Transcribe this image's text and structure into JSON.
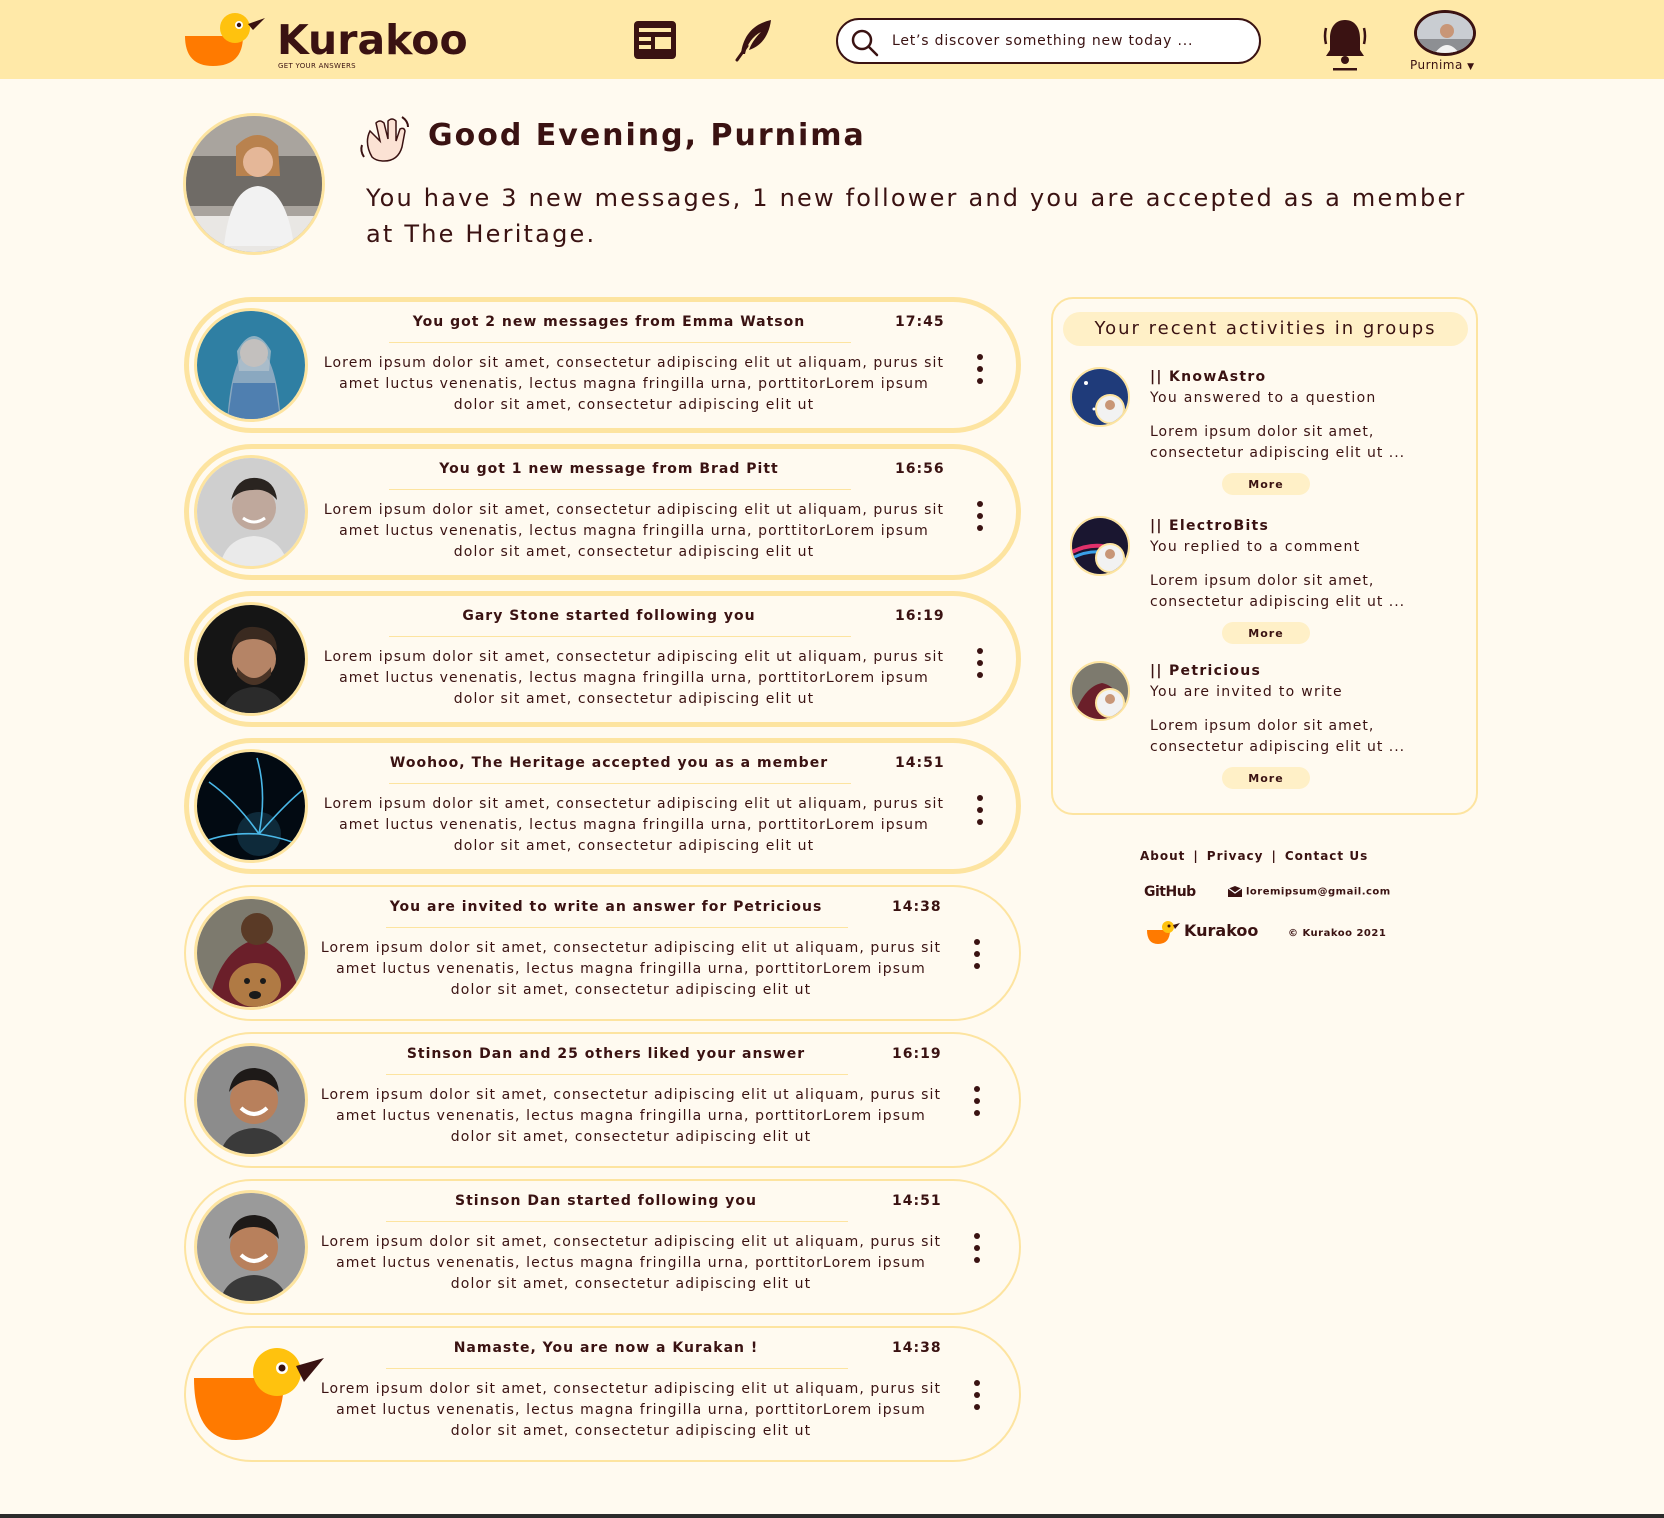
{
  "brand": {
    "name": "Kurakoo",
    "tagline": "GET YOUR ANSWERS"
  },
  "header": {
    "search_placeholder": "Let’s discover something new today ...",
    "user_name": "Purnima"
  },
  "greeting": {
    "title": "Good Evening, Purnima",
    "message": "You have 3 new messages, 1 new follower and you are accepted as a member at The Heritage."
  },
  "notifications": [
    {
      "title": "You got 2 new messages from Emma Watson",
      "time": "17:45",
      "body": "Lorem ipsum dolor sit amet, consectetur adipiscing elit ut aliquam, purus sit amet luctus venenatis, lectus magna fringilla urna, porttitorLorem ipsum dolor sit amet, consectetur adipiscing elit ut"
    },
    {
      "title": "You got 1 new message from Brad Pitt",
      "time": "16:56",
      "body": "Lorem ipsum dolor sit amet, consectetur adipiscing elit ut aliquam, purus sit amet luctus venenatis, lectus magna fringilla urna, porttitorLorem ipsum dolor sit amet, consectetur adipiscing elit ut"
    },
    {
      "title": "Gary Stone started following you",
      "time": "16:19",
      "body": "Lorem ipsum dolor sit amet, consectetur adipiscing elit ut aliquam, purus sit amet luctus venenatis, lectus magna fringilla urna, porttitorLorem ipsum dolor sit amet, consectetur adipiscing elit ut"
    },
    {
      "title": "Woohoo, The Heritage accepted you as a member",
      "time": "14:51",
      "body": "Lorem ipsum dolor sit amet, consectetur adipiscing elit ut aliquam, purus sit amet luctus venenatis, lectus magna fringilla urna, porttitorLorem ipsum dolor sit amet, consectetur adipiscing elit ut"
    },
    {
      "title": "You are invited to write an answer for Petricious",
      "time": "14:38",
      "body": "Lorem ipsum dolor sit amet, consectetur adipiscing elit ut aliquam, purus sit amet luctus venenatis, lectus magna fringilla urna, porttitorLorem ipsum dolor sit amet, consectetur adipiscing elit ut"
    },
    {
      "title": "Stinson Dan and 25 others liked your answer",
      "time": "16:19",
      "body": "Lorem ipsum dolor sit amet, consectetur adipiscing elit ut aliquam, purus sit amet luctus venenatis, lectus magna fringilla urna, porttitorLorem ipsum dolor sit amet, consectetur adipiscing elit ut"
    },
    {
      "title": "Stinson Dan started following you",
      "time": "14:51",
      "body": "Lorem ipsum dolor sit amet, consectetur adipiscing elit ut aliquam, purus sit amet luctus venenatis, lectus magna fringilla urna, porttitorLorem ipsum dolor sit amet, consectetur adipiscing elit ut"
    },
    {
      "title": "Namaste, You are now a Kurakan !",
      "time": "14:38",
      "body": "Lorem ipsum dolor sit amet, consectetur adipiscing elit ut aliquam, purus sit amet luctus venenatis, lectus magna fringilla urna, porttitorLorem ipsum dolor sit amet, consectetur adipiscing elit ut"
    }
  ],
  "groups": {
    "title": "Your recent activities in groups",
    "items": [
      {
        "group": "|| KnowAstro",
        "action": "You answered to a question",
        "text": "Lorem ipsum dolor sit amet, consectetur adipiscing elit ut ...",
        "more": "More"
      },
      {
        "group": "|| ElectroBits",
        "action": "You replied to a comment",
        "text": "Lorem ipsum dolor sit amet, consectetur adipiscing elit ut ...",
        "more": "More"
      },
      {
        "group": "|| Petricious",
        "action": "You are invited to write",
        "text": "Lorem ipsum dolor sit amet, consectetur adipiscing elit ut ...",
        "more": "More"
      }
    ]
  },
  "footer": {
    "about": "About",
    "privacy": "Privacy",
    "contact": "Contact Us",
    "separator": "|",
    "github": "GitHub",
    "email": "loremipsum@gmail.com",
    "brand": "Kurakoo",
    "copyright": "© Kurakoo 2021"
  },
  "colors": {
    "header_bg": "#ffe9a8",
    "page_bg": "#fffaf0",
    "accent_border": "#fde4a0",
    "text": "#3a1212",
    "brand_orange": "#ff7a00",
    "brand_yellow": "#ffc20e"
  },
  "icons": [
    "feed-icon",
    "write-icon",
    "search-icon",
    "bell-icon",
    "chevron-down-icon",
    "more-vertical-icon",
    "mail-icon",
    "wave-hand-icon"
  ]
}
